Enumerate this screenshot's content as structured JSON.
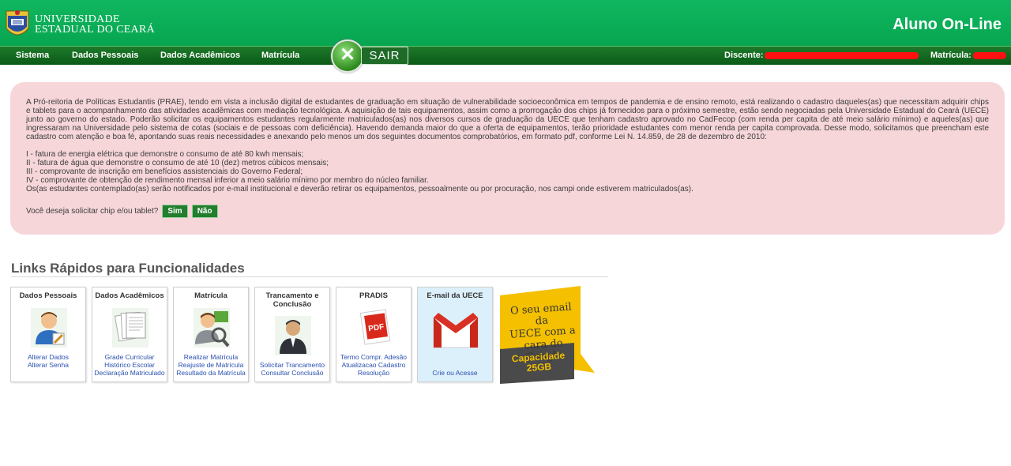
{
  "header": {
    "university_line1": "UNIVERSIDADE",
    "university_line2": "ESTADUAL DO CEARÁ",
    "app_title": "Aluno On-Line"
  },
  "nav": {
    "items": [
      "Sistema",
      "Dados Pessoais",
      "Dados Acadêmicos",
      "Matrícula"
    ],
    "sair_label": "SAIR",
    "discente_label": "Discente:",
    "matricula_label": "Matrícula:"
  },
  "notice": {
    "paragraph": "A Pró-reitoria de Políticas Estudantis (PRAE), tendo em vista a inclusão digital de estudantes de graduação em situação de vulnerabilidade socioeconômica em tempos de pandemia e de ensino remoto, está realizando o cadastro daqueles(as) que necessitam adquirir chips e tablets para o acompanhamento das atividades acadêmicas com mediação tecnológica. A aquisição de tais equipamentos, assim como a prorrogação dos chips já fornecidos para o próximo semestre, estão sendo negociadas pela Universidade Estadual do Ceará (UECE) junto ao governo do estado. Poderão solicitar os equipamentos estudantes regularmente matriculados(as) nos diversos cursos de graduação da UECE que tenham cadastro aprovado no CadFecop (com renda per capita de até meio salário mínimo) e aqueles(as) que ingressaram na Universidade pelo sistema de cotas (sociais e de pessoas com deficiência). Havendo demanda maior do que a oferta de equipamentos, terão prioridade estudantes com menor renda per capita comprovada. Desse modo, solicitamos que preencham este cadastro com atenção e boa fé, apontando suas reais necessidades e anexando pelo menos um dos seguintes documentos comprobatórios, em formato pdf, conforme Lei N. 14.859, de 28 de dezembro de 2010:",
    "list": [
      "I - fatura de energia elétrica que demonstre o consumo de até 80 kwh mensais;",
      "II - fatura de água que demonstre o consumo de até 10 (dez) metros cúbicos mensais;",
      "III - comprovante de inscrição em benefícios assistenciais do Governo Federal;",
      "IV - comprovante de obtenção de rendimento mensal inferior a meio salário mínimo por membro do núcleo familiar.",
      "Os(as estudantes contemplado(as) serão notificados por e-mail institucional e deverão retirar os equipamentos, pessoalmente ou por procuração, nos campi onde estiverem matriculados(as)."
    ],
    "question": "Você deseja solicitar chip e/ou tablet?",
    "yes_label": "Sim",
    "no_label": "Não"
  },
  "quick_links": {
    "title": "Links Rápidos para Funcionalidades",
    "cards": [
      {
        "title": "Dados Pessoais",
        "icon": "user-edit-icon",
        "links": [
          "Alterar Dados",
          "Alterar Senha"
        ]
      },
      {
        "title": "Dados Acadêmicos",
        "icon": "documents-icon",
        "links": [
          "Grade Curricular",
          "Histórico Escolar",
          "Declaração Matriculado"
        ]
      },
      {
        "title": "Matrícula",
        "icon": "user-search-icon",
        "links": [
          "Realizar Matrícula",
          "Reajuste de Matrícula",
          "Resultado da Matrícula"
        ]
      },
      {
        "title": "Trancamento e Conclusão",
        "icon": "graduate-icon",
        "links": [
          "Solicitar Trancamento",
          "Consultar Conclusão"
        ]
      },
      {
        "title": "PRADIS",
        "icon": "pdf-icon",
        "links": [
          "Termo Compr. Adesão",
          "Atualizacao Cadastro",
          "Resolução"
        ]
      },
      {
        "title": "E-mail da UECE",
        "icon": "gmail-icon",
        "links": [
          "Crie ou Acesse"
        ]
      }
    ],
    "banner": {
      "line1": "O seu email da",
      "line2": "UECE com a",
      "line3": "cara do Google",
      "cap1": "Capacidade",
      "cap2": "25GB"
    }
  },
  "colors": {
    "header_green": "#0aa855",
    "nav_green": "#136b1f",
    "notice_bg": "#f6d6d9",
    "link_blue": "#2a4fb0",
    "redaction_red": "#ff1010"
  }
}
